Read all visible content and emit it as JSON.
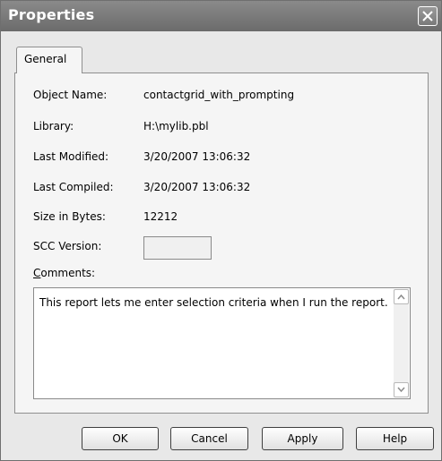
{
  "window": {
    "title": "Properties",
    "close_icon": "close-icon"
  },
  "tabs": [
    {
      "label": "General",
      "selected": true
    }
  ],
  "fields": {
    "object_name": {
      "label": "Object Name:",
      "value": "contactgrid_with_prompting"
    },
    "library": {
      "label": "Library:",
      "value": "H:\\mylib.pbl"
    },
    "last_modified": {
      "label": "Last Modified:",
      "value": "3/20/2007 13:06:32"
    },
    "last_compiled": {
      "label": "Last Compiled:",
      "value": "3/20/2007 13:06:32"
    },
    "size_in_bytes": {
      "label": "Size in Bytes:",
      "value": "12212"
    },
    "scc_version": {
      "label": "SCC Version:",
      "value": ""
    }
  },
  "comments": {
    "label_first": "C",
    "label_rest": "omments:",
    "text": "This report lets me enter selection criteria when I run the report."
  },
  "buttons": {
    "ok": "OK",
    "cancel": "Cancel",
    "apply": "Apply",
    "help": "Help"
  },
  "icons": {
    "scroll_up": "scroll-up-arrow-icon",
    "scroll_down": "scroll-down-arrow-icon"
  }
}
